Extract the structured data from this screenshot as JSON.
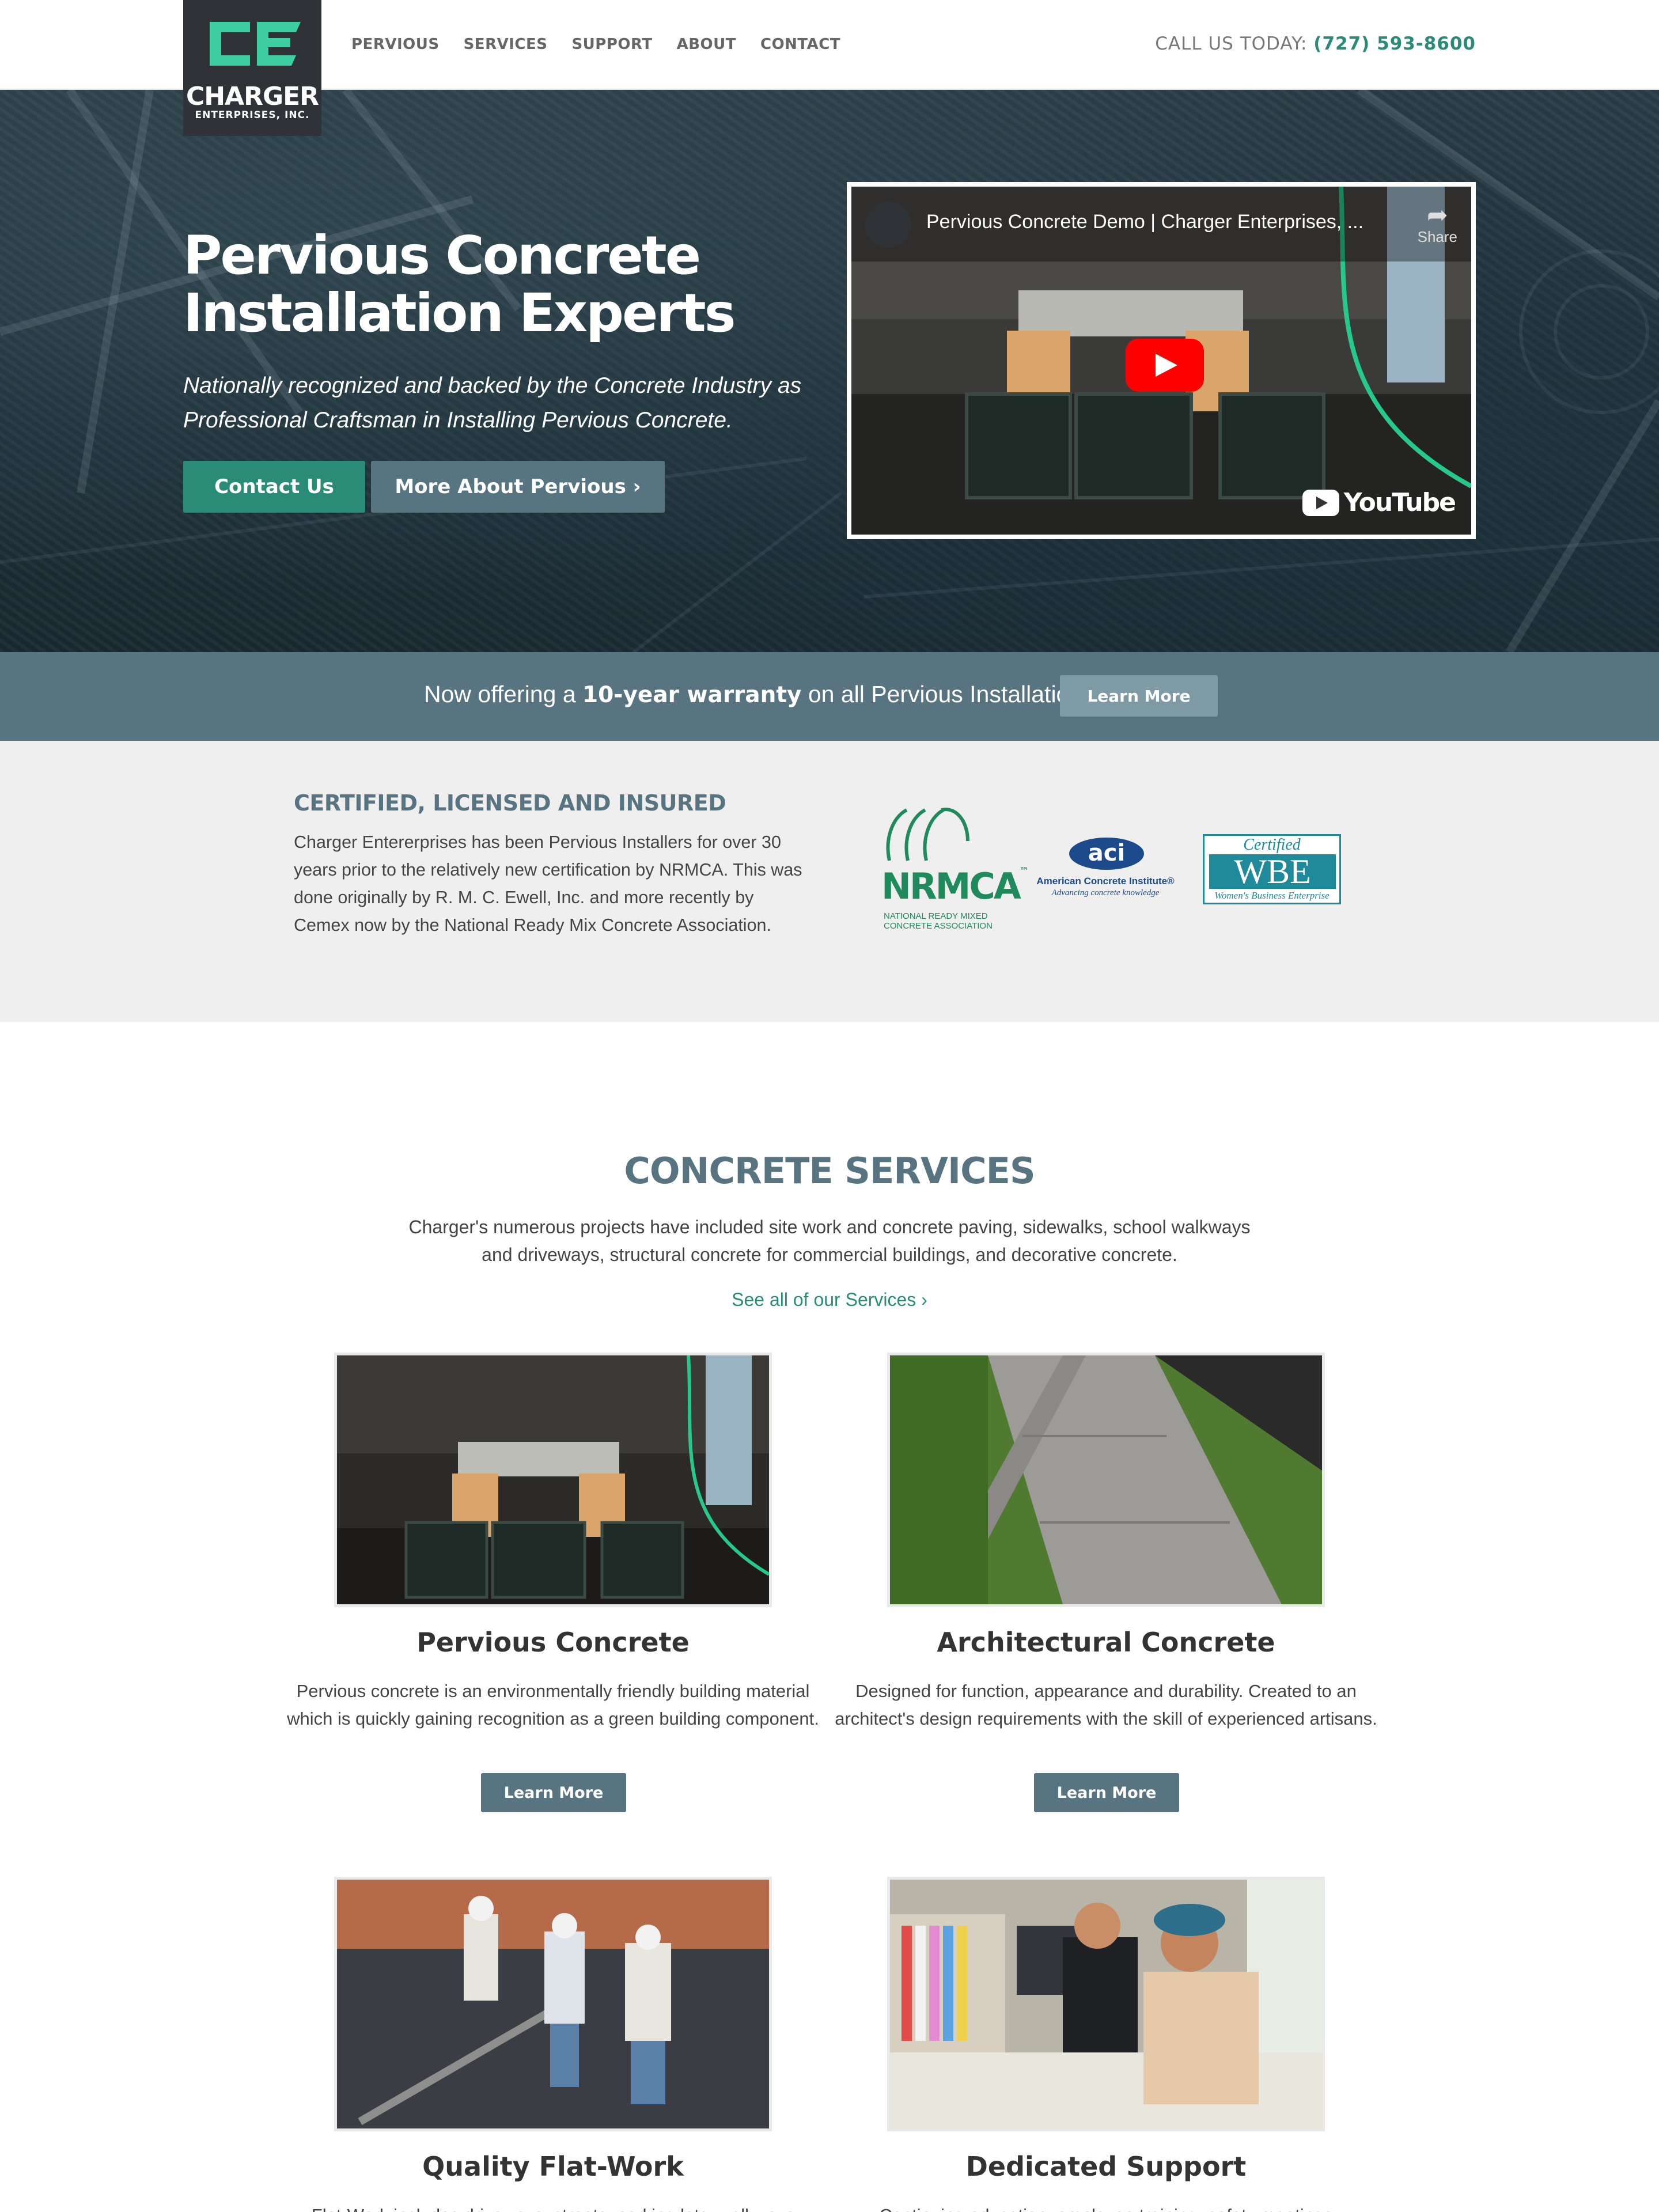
{
  "header": {
    "logo": {
      "name": "CHARGER",
      "subtitle": "ENTERPRISES, INC."
    },
    "nav": [
      "PERVIOUS",
      "SERVICES",
      "SUPPORT",
      "ABOUT",
      "CONTACT"
    ],
    "phone_label": "CALL US TODAY:",
    "phone_number": "(727) 593-8600"
  },
  "hero": {
    "title_line1": "Pervious Concrete",
    "title_line2": "Installation Experts",
    "subtitle": "Nationally recognized and backed by the Concrete Industry as Professional Craftsman in Installing Pervious Concrete.",
    "primary_button": "Contact Us",
    "secondary_button": "More About Pervious ›",
    "video": {
      "title": "Pervious Concrete Demo | Charger Enterprises, ...",
      "share_label": "Share",
      "brand": "YouTube"
    }
  },
  "warranty": {
    "text_before": "Now offering a ",
    "text_bold": "10-year warranty",
    "text_after": " on all Pervious Installations!",
    "button": "Learn More"
  },
  "certified": {
    "heading": "CERTIFIED, LICENSED AND INSURED",
    "body": "Charger Entererprises has been Pervious Installers for over 30 years prior to the relatively new certification by NRMCA. This was done originally by R. M. C. Ewell, Inc. and more recently by Cemex now by the National Ready Mix Concrete Association.",
    "logos": {
      "nrmca": {
        "word": "NRMCA",
        "tm": "™",
        "caption": "NATIONAL READY MIXED CONCRETE ASSOCIATION"
      },
      "aci": {
        "mark": "aci",
        "name": "American Concrete Institute®",
        "tagline": "Advancing concrete knowledge"
      },
      "wbe": {
        "certified": "Certified",
        "word": "WBE",
        "caption": "Women's Business Enterprise"
      }
    }
  },
  "services": {
    "title": "CONCRETE SERVICES",
    "intro": "Charger's numerous projects have included site work and concrete paving, sidewalks, school walkways and driveways, structural concrete for commercial buildings, and decorative concrete.",
    "see_all": "See all of our Services ›",
    "cards": [
      {
        "title": "Pervious Concrete",
        "text": "Pervious concrete is an environmentally friendly building material which is quickly gaining recognition as a green building component.",
        "button": "Learn More"
      },
      {
        "title": "Architectural Concrete",
        "text": "Designed for function, appearance and durability. Created to an architect's design requirements with the skill of experienced artisans.",
        "button": "Learn More"
      },
      {
        "title": "Quality Flat-Work",
        "text": "Flat-Work includes driveways, streets, parking lots, walkways",
        "button": ""
      },
      {
        "title": "Dedicated Support",
        "text": "Continuing education, employee training, safety meetings",
        "button": ""
      }
    ]
  },
  "colors": {
    "accent_green": "#2a8c76",
    "slate": "#577480",
    "logo_bg": "#2f3237",
    "logo_mark": "#3ecfa0"
  }
}
